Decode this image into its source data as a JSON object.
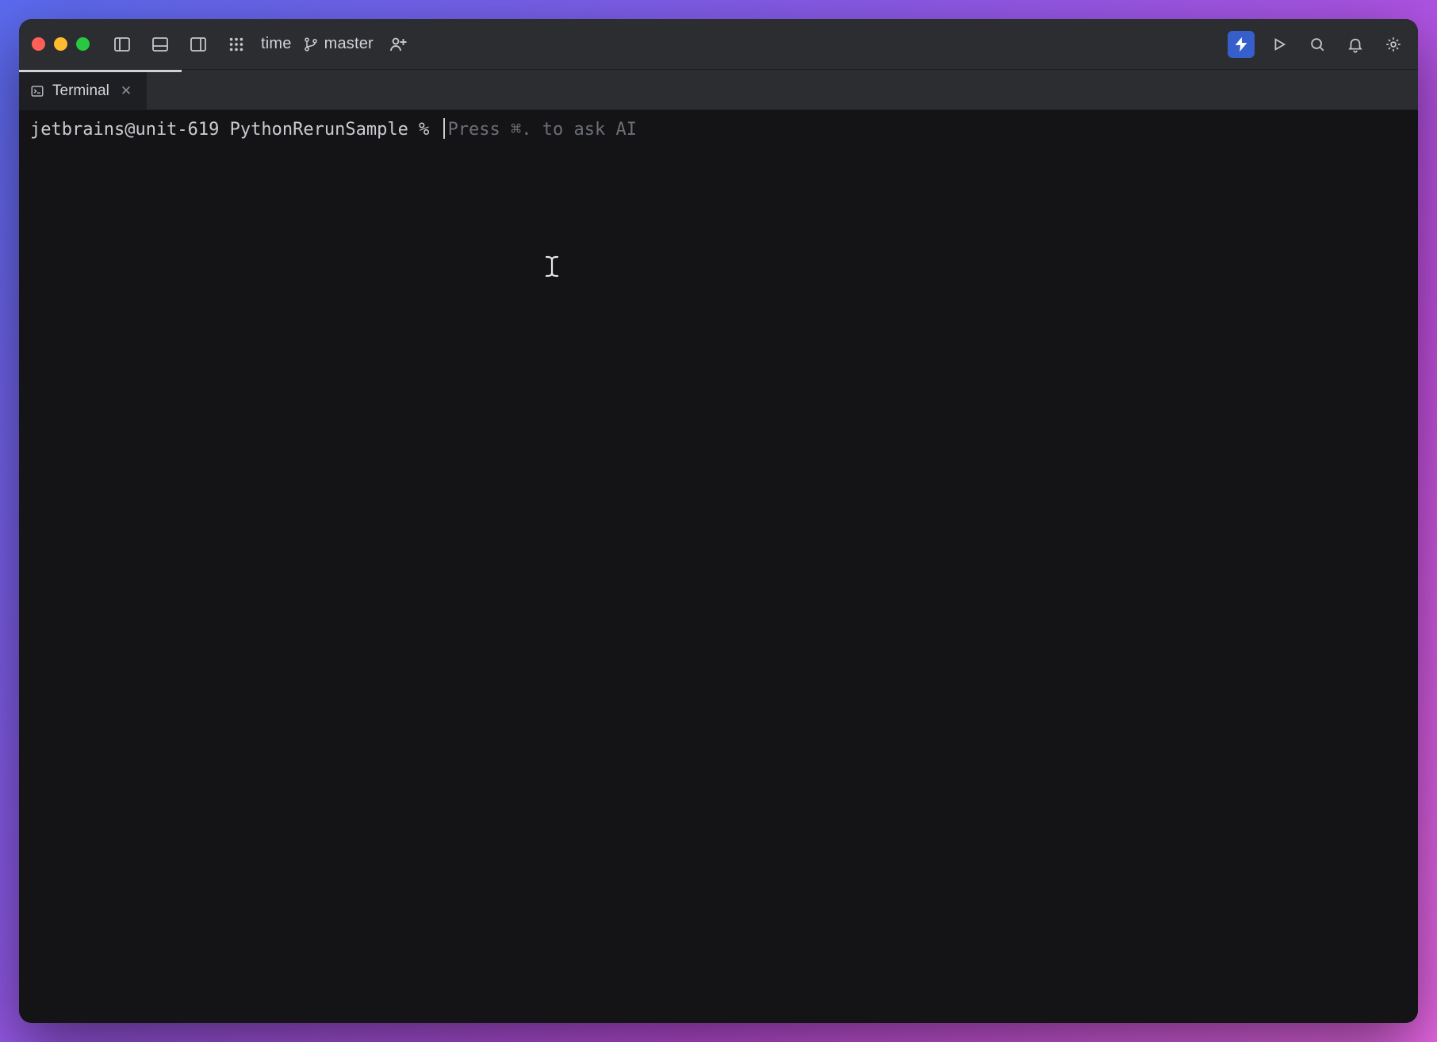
{
  "window": {
    "project_label": "time",
    "branch_label": "master"
  },
  "tabs": {
    "active": {
      "label": "Terminal"
    }
  },
  "terminal": {
    "prompt": "jetbrains@unit-619 PythonRerunSample % ",
    "hint": "Press ⌘. to ask AI"
  },
  "icons": {
    "ai": "ai-bolt-icon"
  }
}
